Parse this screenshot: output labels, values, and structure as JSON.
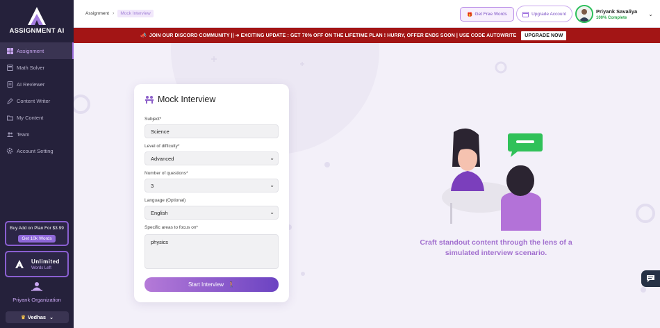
{
  "app": {
    "name": "ASSIGNMENT AI"
  },
  "sidebar": {
    "items": [
      {
        "label": "Assignment",
        "icon": "grid-icon",
        "active": true
      },
      {
        "label": "Math Solver",
        "icon": "calculator-icon"
      },
      {
        "label": "AI Reviewer",
        "icon": "document-icon"
      },
      {
        "label": "Content Writer",
        "icon": "pen-icon"
      },
      {
        "label": "My Content",
        "icon": "folder-icon"
      },
      {
        "label": "Team",
        "icon": "team-icon"
      },
      {
        "label": "Account Setting",
        "icon": "gear-icon"
      }
    ],
    "promo": {
      "text": "Buy Add on Plan For $3.99",
      "button": "Get 10k Words"
    },
    "unlimited": {
      "title": "Unlimited",
      "sub": "Words Left"
    },
    "org_name": "Priyank Organization",
    "workspace": "Vedhas"
  },
  "topbar": {
    "breadcrumb": [
      "Assignment",
      "Mock Interview"
    ],
    "free_words": "Get Free Words",
    "upgrade": "Upgrade Account",
    "user": {
      "name": "Priyank Savaliya",
      "sub": "100% Complete"
    }
  },
  "banner": {
    "text": "JOIN OUR DISCORD COMMUNITY || ➜ EXCITING UPDATE : GET 70% OFF ON THE LIFETIME PLAN ! HURRY, OFFER ENDS SOON | USE CODE AUTOWRITE",
    "button": "UPGRADE NOW"
  },
  "form": {
    "title": "Mock Interview",
    "subject_label": "Subject*",
    "subject_value": "Science",
    "difficulty_label": "Level of difficulty*",
    "difficulty_value": "Advanced",
    "questions_label": "Number of questions*",
    "questions_value": "3",
    "language_label": "Language (Optional)",
    "language_value": "English",
    "areas_label": "Specific areas to focus on*",
    "areas_value": "physics",
    "submit": "Start Interview"
  },
  "illustration": {
    "tagline": "Craft standout content through the lens of a simulated interview scenario."
  },
  "colors": {
    "sidebar": "#25213b",
    "accent": "#8a5fd1",
    "banner": "#a31515",
    "button_from": "#b57ad8",
    "button_to": "#6b43c2",
    "tagline": "#a270cf"
  }
}
